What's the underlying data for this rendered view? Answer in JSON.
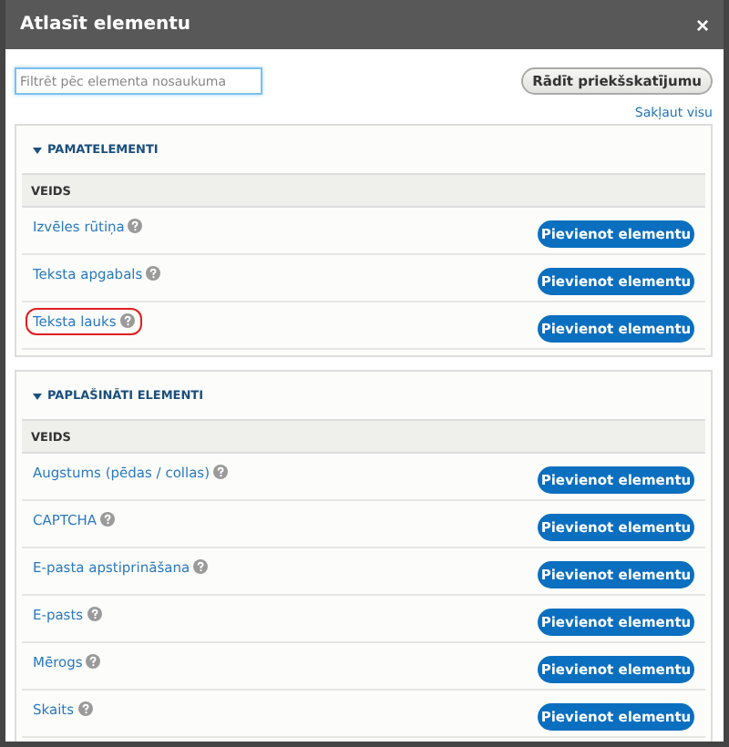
{
  "window": {
    "title": "Atlasīt elementu",
    "close": "×"
  },
  "filter": {
    "placeholder": "Filtrēt pēc elementa nosaukuma"
  },
  "preview_button": "Rādīt priekšskatījumu",
  "collapse_all": "Sakļaut visu",
  "sections": [
    {
      "title": "PAMATELEMENTI",
      "expanded": true,
      "column": "VEIDS",
      "items": [
        {
          "label": "Izvēles rūtiņa",
          "highlighted": false,
          "button": "Pievienot elementu"
        },
        {
          "label": "Teksta apgabals",
          "highlighted": false,
          "button": "Pievienot elementu"
        },
        {
          "label": "Teksta lauks",
          "highlighted": true,
          "button": "Pievienot elementu"
        }
      ]
    },
    {
      "title": "PAPLAŠINĀTI ELEMENTI",
      "expanded": true,
      "column": "VEIDS",
      "items": [
        {
          "label": "Augstums (pēdas / collas)",
          "highlighted": false,
          "button": "Pievienot elementu"
        },
        {
          "label": "CAPTCHA",
          "highlighted": false,
          "button": "Pievienot elementu"
        },
        {
          "label": "E-pasta apstiprināšana",
          "highlighted": false,
          "button": "Pievienot elementu"
        },
        {
          "label": "E-pasts",
          "highlighted": false,
          "button": "Pievienot elementu"
        },
        {
          "label": "Mērogs",
          "highlighted": false,
          "button": "Pievienot elementu"
        },
        {
          "label": "Skaits",
          "highlighted": false,
          "button": "Pievienot elementu"
        }
      ]
    }
  ]
}
